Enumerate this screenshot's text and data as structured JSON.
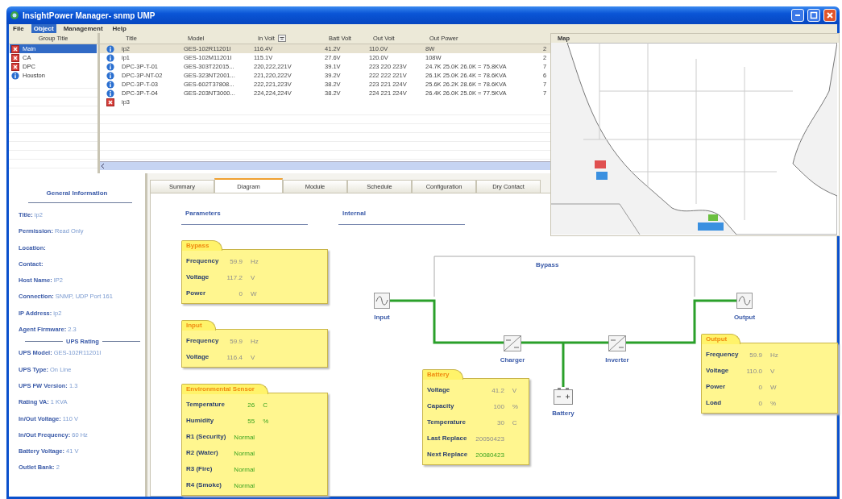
{
  "window": {
    "title": "InsightPower Manager- snmp UMP"
  },
  "menu": [
    {
      "label": "File",
      "selected": false
    },
    {
      "label": "Object",
      "selected": true
    },
    {
      "label": "Management",
      "selected": false
    },
    {
      "label": "Help",
      "selected": false
    }
  ],
  "groups": {
    "header": "Group Title",
    "items": [
      {
        "label": "Main",
        "kind": "alarm",
        "selected": true
      },
      {
        "label": "CA",
        "kind": "alarm",
        "selected": false
      },
      {
        "label": "DPC",
        "kind": "alarm",
        "selected": false
      },
      {
        "label": "Houston",
        "kind": "normal",
        "selected": false
      }
    ]
  },
  "table": {
    "columns": [
      "Title",
      "Model",
      "In Volt",
      "Batt Volt",
      "Out Volt",
      "Out Power"
    ],
    "rows": [
      {
        "kind": "normal",
        "selected": true,
        "cells": [
          "ip2",
          "GES-102R11201I",
          "116.4V",
          "41.2V",
          "110.0V",
          "8W",
          "2"
        ]
      },
      {
        "kind": "normal",
        "selected": false,
        "cells": [
          "ip1",
          "GES-102M11201I",
          "115.1V",
          "27.6V",
          "120.0V",
          "108W",
          "2"
        ]
      },
      {
        "kind": "normal",
        "selected": false,
        "cells": [
          "DPC-3P-T-01",
          "GES-303T22015...",
          "220,222,221V",
          "39.1V",
          "223 220 223V",
          "24.7K 25.0K 26.0K = 75.8KVA",
          "7"
        ]
      },
      {
        "kind": "normal",
        "selected": false,
        "cells": [
          "DPC-3P-NT-02",
          "GES-323NT2001...",
          "221,220,222V",
          "39.2V",
          "222 222 221V",
          "26.1K 25.0K 26.4K = 78.6KVA",
          "6"
        ]
      },
      {
        "kind": "normal",
        "selected": false,
        "cells": [
          "DPC-3P-T-03",
          "GES-602T37808...",
          "222,221,223V",
          "38.2V",
          "223 221 224V",
          "25.6K 26.2K 28.6K = 78.6KVA",
          "7"
        ]
      },
      {
        "kind": "normal",
        "selected": false,
        "cells": [
          "DPC-3P-T-04",
          "GES-203NT3000...",
          "224,224,224V",
          "38.2V",
          "224 221 224V",
          "26.4K 26.0K 25.0K = 77.5KVA",
          "7"
        ]
      },
      {
        "kind": "alarm",
        "selected": false,
        "cells": [
          "ip3"
        ]
      }
    ]
  },
  "map": {
    "title": "Map"
  },
  "info": {
    "title": "General Information",
    "fields": [
      {
        "label": "Title:",
        "value": "ip2"
      },
      {
        "label": "Permission:",
        "value": "Read Only"
      },
      {
        "label": "Location:"
      },
      {
        "label": "Contact:"
      },
      {
        "label": "Host Name:",
        "value": "IP2"
      },
      {
        "label": "Connection:",
        "value": "SNMP, UDP Port 161"
      },
      {
        "label": "IP Address:",
        "value": "ip2"
      },
      {
        "label": "Agent Firmware:",
        "value": "2.3"
      }
    ],
    "section": "UPS Rating",
    "rating_fields": [
      {
        "label": "UPS Model:",
        "value": "GES-102R11201I"
      },
      {
        "label": "UPS Type:",
        "value": "On Line"
      },
      {
        "label": "UPS FW Version:",
        "value": "1.3"
      },
      {
        "label": "Rating VA:",
        "value": "1 KVA"
      },
      {
        "label": "In/Out Voltage:",
        "value": "110 V"
      },
      {
        "label": "In/Out Frequency:",
        "value": "60 Hz"
      },
      {
        "label": "Battery Voltage:",
        "value": "41 V"
      },
      {
        "label": "Outlet Bank:",
        "value": "2"
      }
    ]
  },
  "tabs": [
    {
      "label": "Summary",
      "selected": false
    },
    {
      "label": "Diagram",
      "selected": true
    },
    {
      "label": "Module",
      "selected": false
    },
    {
      "label": "Schedule",
      "selected": false
    },
    {
      "label": "Configuration",
      "selected": false
    },
    {
      "label": "Dry Contact",
      "selected": false
    }
  ],
  "diagram": {
    "parameters_heading": "Parameters",
    "internal_heading": "Internal",
    "bypass_label": "Bypass",
    "parameter_cards": [
      {
        "title": "Bypass",
        "rows": [
          {
            "label": "Frequency",
            "value": "59.9",
            "unit": "Hz",
            "highlight": false
          },
          {
            "label": "Voltage",
            "value": "117.2",
            "unit": "V",
            "highlight": false
          },
          {
            "label": "Power",
            "value": "0",
            "unit": "W",
            "highlight": false
          }
        ]
      },
      {
        "title": "Input",
        "rows": [
          {
            "label": "Frequency",
            "value": "59.9",
            "unit": "Hz",
            "highlight": false
          },
          {
            "label": "Voltage",
            "value": "116.4",
            "unit": "V",
            "highlight": false
          }
        ]
      },
      {
        "title": "Environmental Sensor",
        "rows": [
          {
            "label": "Temperature",
            "value": "26",
            "unit": "C",
            "highlight": true
          },
          {
            "label": "Humidity",
            "value": "55",
            "unit": "%",
            "highlight": true
          },
          {
            "label": "R1 (Security)",
            "value": "Normal",
            "highlight": true
          },
          {
            "label": "R2 (Water)",
            "value": "Normal",
            "highlight": true
          },
          {
            "label": "R3 (Fire)",
            "value": "Normal",
            "highlight": true
          },
          {
            "label": "R4 (Smoke)",
            "value": "Normal",
            "highlight": true
          }
        ]
      }
    ],
    "nodes": [
      {
        "label": "Input",
        "kind": "sine"
      },
      {
        "label": "Charger",
        "kind": "converter"
      },
      {
        "label": "Inverter",
        "kind": "converter"
      },
      {
        "label": "Battery",
        "kind": "battery"
      },
      {
        "label": "Output",
        "kind": "sine"
      }
    ],
    "internal_cards": [
      {
        "title": "Battery",
        "rows": [
          {
            "label": "Voltage",
            "value": "41.2",
            "unit": "V",
            "highlight": false
          },
          {
            "label": "Capacity",
            "value": "100",
            "unit": "%",
            "highlight": false
          },
          {
            "label": "Temperature",
            "value": "30",
            "unit": "C",
            "highlight": false
          },
          {
            "label": "Last Replace",
            "value": "20050423",
            "highlight": false
          },
          {
            "label": "Next Replace",
            "value": "20080423",
            "highlight": true
          }
        ]
      },
      {
        "title": "Output",
        "rows": [
          {
            "label": "Frequency",
            "value": "59.9",
            "unit": "Hz",
            "highlight": false
          },
          {
            "label": "Voltage",
            "value": "110.0",
            "unit": "V",
            "highlight": false
          },
          {
            "label": "Power",
            "value": "0",
            "unit": "W",
            "highlight": false
          },
          {
            "label": "Load",
            "value": "0",
            "unit": "%",
            "highlight": false
          }
        ]
      }
    ]
  }
}
